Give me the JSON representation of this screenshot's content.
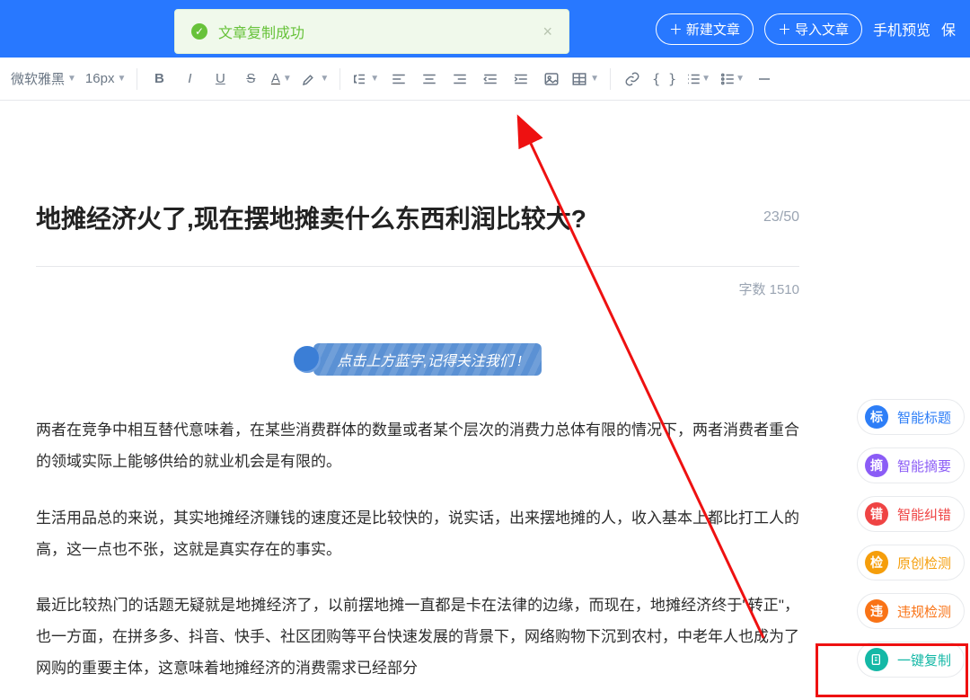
{
  "toast": {
    "message": "文章复制成功"
  },
  "header": {
    "new_article": "新建文章",
    "import_article": "导入文章",
    "mobile_preview": "手机预览",
    "save": "保"
  },
  "toolbar": {
    "font_family": "微软雅黑",
    "font_size": "16px"
  },
  "article": {
    "title": "地摊经济火了,现在摆地摊卖什么东西利润比较大?",
    "title_count": "23/50",
    "word_count_label": "字数 1510",
    "pill_text": "点击上方蓝字,记得关注我们 !",
    "paragraphs": [
      "两者在竞争中相互替代意味着，在某些消费群体的数量或者某个层次的消费力总体有限的情况下，两者消费者重合的领域实际上能够供给的就业机会是有限的。",
      "生活用品总的来说，其实地摊经济赚钱的速度还是比较快的，说实话，出来摆地摊的人，收入基本上都比打工人的高，这一点也不张，这就是真实存在的事实。",
      "最近比较热门的话题无疑就是地摊经济了，以前摆地摊一直都是卡在法律的边缘，而现在，地摊经济终于\"转正\"，也一方面，在拼多多、抖音、快手、社区团购等平台快速发展的背景下，网络购物下沉到农村，中老年人也成为了网购的重要主体，这意味着地摊经济的消费需求已经部分"
    ]
  },
  "side": {
    "title": {
      "glyph": "标",
      "label": "智能标题"
    },
    "summary": {
      "glyph": "摘",
      "label": "智能摘要"
    },
    "correct": {
      "glyph": "错",
      "label": "智能纠错"
    },
    "original": {
      "glyph": "检",
      "label": "原创检测"
    },
    "violation": {
      "glyph": "违",
      "label": "违规检测"
    },
    "copy": {
      "glyph": "",
      "label": "一键复制"
    }
  }
}
